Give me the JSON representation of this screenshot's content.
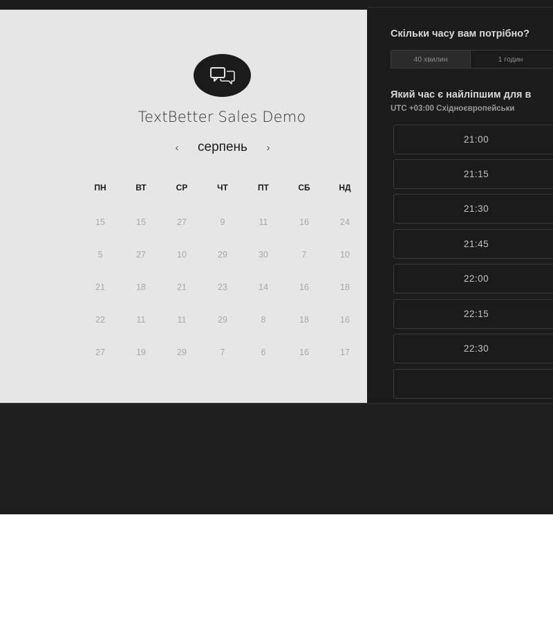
{
  "left": {
    "logo_icon": "chat-bubbles-icon",
    "product_title": "TextBetter Sales Demo",
    "month": "серпень",
    "prev_arrow": "‹",
    "next_arrow": "›",
    "weekdays": [
      "ПН",
      "ВТ",
      "СР",
      "ЧТ",
      "ПТ",
      "СБ",
      "НД"
    ],
    "weeks": [
      [
        "15",
        "15",
        "27",
        "9",
        "11",
        "16",
        "24"
      ],
      [
        "5",
        "27",
        "10",
        "29",
        "30",
        "7",
        "10"
      ],
      [
        "21",
        "18",
        "21",
        "23",
        "14",
        "16",
        "18"
      ],
      [
        "22",
        "11",
        "11",
        "29",
        "8",
        "18",
        "16"
      ],
      [
        "27",
        "19",
        "29",
        "7",
        "6",
        "16",
        "17"
      ]
    ]
  },
  "right": {
    "duration_question": "Скільки часу вам потрібно?",
    "durations": [
      "40 хвилин",
      "1 годин"
    ],
    "time_question": "Який час є найліпшим для в",
    "timezone": "UTC +03:00 Східноєвропейськи",
    "slots": [
      "21:00",
      "21:15",
      "21:30",
      "21:45",
      "22:00",
      "22:15",
      "22:30"
    ]
  }
}
